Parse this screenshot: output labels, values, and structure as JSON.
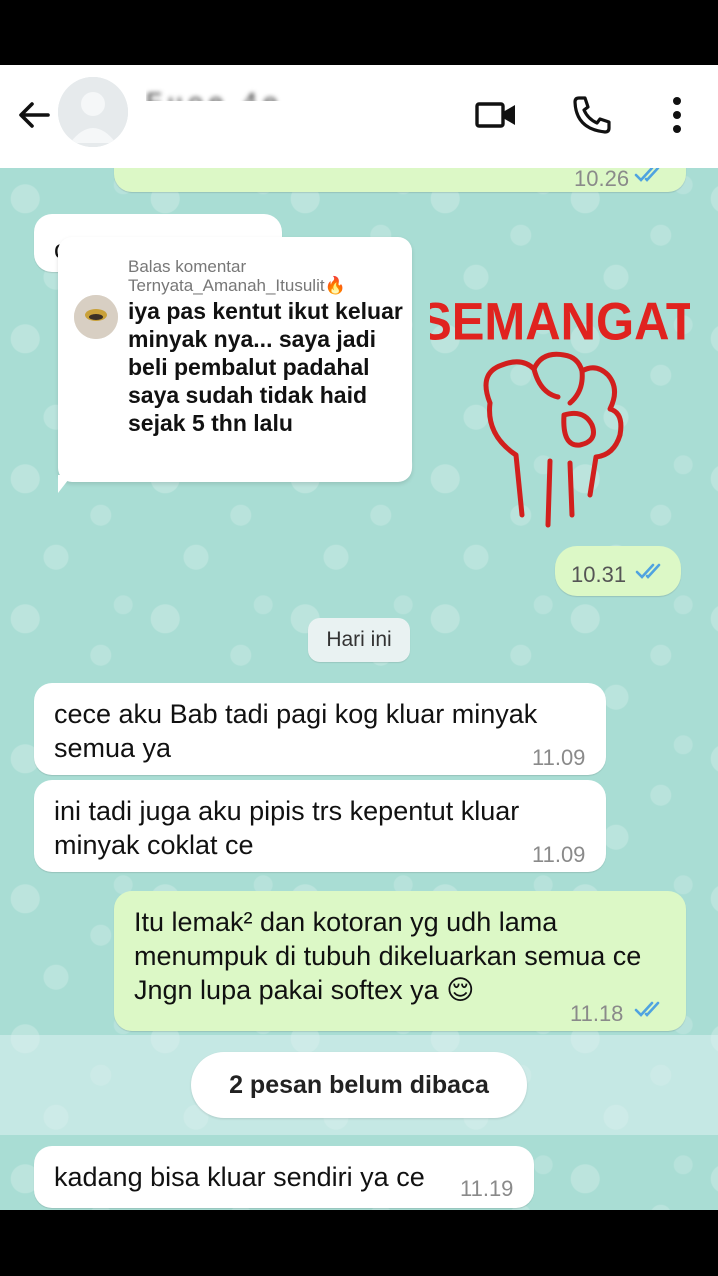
{
  "header": {
    "contact_name": "Fuoe 4e"
  },
  "chat": {
    "top_bubble": {
      "time": "10.26"
    },
    "partial_bubble": {
      "text": "ol... "
    },
    "reply_overlay": {
      "title": "Balas komentar",
      "username": "Ternyata_Amanah_Itusulit🔥",
      "comment": "iya pas kentut ikut keluar minyak nya... saya jadi beli pembalut padahal saya sudah tidak haid sejak 5 thn lalu"
    },
    "sticker": {
      "text": "SEMANGAT",
      "time": "10.31"
    },
    "date_divider": "Hari ini",
    "messages": [
      {
        "direction": "incoming",
        "text": "cece aku Bab tadi pagi kog kluar minyak\nsemua ya",
        "time": "11.09"
      },
      {
        "direction": "incoming",
        "text": "ini tadi juga aku pipis trs kepentut kluar\nminyak coklat ce",
        "time": "11.09"
      },
      {
        "direction": "outgoing",
        "text": "Itu lemak² dan kotoran yg udh lama\nmenumpuk di tubuh dikeluarkan semua ce\nJngn lupa pakai softex ya 😌",
        "time": "11.18"
      }
    ],
    "unread_label": "2 pesan belum dibaca",
    "last_message": {
      "direction": "incoming",
      "text": "kadang bisa kluar sendiri ya ce",
      "time": "11.19"
    }
  },
  "colors": {
    "chat_background": "#a9ddd4",
    "outgoing_bubble": "#dcf8c6",
    "tick_read": "#4fa3e0",
    "sticker_red": "#e0231f"
  },
  "icons": {
    "back": "arrow-left-icon",
    "video": "video-camera-icon",
    "phone": "phone-icon",
    "menu": "more-vertical-icon"
  }
}
